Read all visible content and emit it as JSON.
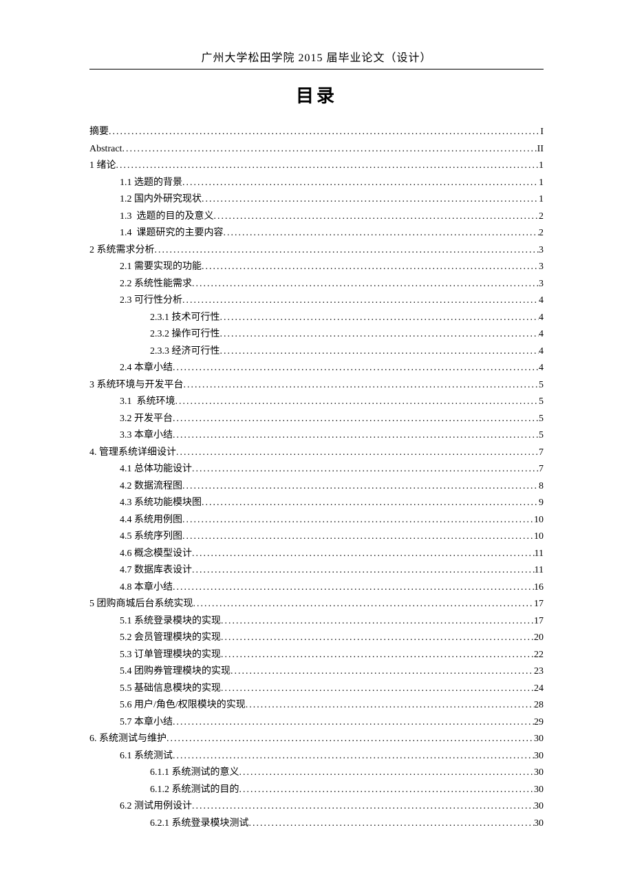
{
  "header": "广州大学松田学院 2015 届毕业论文（设计）",
  "title": "目录",
  "toc": [
    {
      "level": 0,
      "label": "摘要",
      "page": "I"
    },
    {
      "level": 0,
      "label": "Abstract",
      "page": "II"
    },
    {
      "level": 0,
      "label": "1 绪论",
      "page": "1"
    },
    {
      "level": 1,
      "label": "1.1 选题的背景",
      "page": "1"
    },
    {
      "level": 1,
      "label": "1.2 国内外研究现状",
      "page": "1"
    },
    {
      "level": 1,
      "label": "1.3  选题的目的及意义",
      "page": "2"
    },
    {
      "level": 1,
      "label": "1.4  课题研究的主要内容",
      "page": "2"
    },
    {
      "level": 0,
      "label": "2 系统需求分析",
      "page": "3"
    },
    {
      "level": 1,
      "label": "2.1 需要实现的功能",
      "page": "3"
    },
    {
      "level": 1,
      "label": "2.2 系统性能需求",
      "page": "3"
    },
    {
      "level": 1,
      "label": "2.3 可行性分析",
      "page": "4"
    },
    {
      "level": 2,
      "label": "2.3.1 技术可行性",
      "page": "4"
    },
    {
      "level": 2,
      "label": "2.3.2 操作可行性",
      "page": "4"
    },
    {
      "level": 2,
      "label": "2.3.3 经济可行性",
      "page": "4"
    },
    {
      "level": 1,
      "label": "2.4 本章小结",
      "page": "4"
    },
    {
      "level": 0,
      "label": "3 系统环境与开发平台",
      "page": "5"
    },
    {
      "level": 1,
      "label": "3.1  系统环境",
      "page": "5"
    },
    {
      "level": 1,
      "label": "3.2 开发平台",
      "page": "5"
    },
    {
      "level": 1,
      "label": "3.3 本章小结",
      "page": "5"
    },
    {
      "level": 0,
      "label": "4. 管理系统详细设计",
      "page": "7"
    },
    {
      "level": 1,
      "label": "4.1 总体功能设计",
      "page": "7"
    },
    {
      "level": 1,
      "label": "4.2 数据流程图",
      "page": "8"
    },
    {
      "level": 1,
      "label": "4.3 系统功能模块图",
      "page": "9"
    },
    {
      "level": 1,
      "label": "4.4 系统用例图",
      "page": "10"
    },
    {
      "level": 1,
      "label": "4.5 系统序列图",
      "page": "10"
    },
    {
      "level": 1,
      "label": "4.6 概念模型设计",
      "page": "11"
    },
    {
      "level": 1,
      "label": "4.7 数据库表设计",
      "page": "11"
    },
    {
      "level": 1,
      "label": "4.8 本章小结",
      "page": "16"
    },
    {
      "level": 0,
      "label": "5 团购商城后台系统实现",
      "page": "17"
    },
    {
      "level": 1,
      "label": "5.1 系统登录模块的实现",
      "page": "17"
    },
    {
      "level": 1,
      "label": "5.2 会员管理模块的实现",
      "page": "20"
    },
    {
      "level": 1,
      "label": "5.3 订单管理模块的实现",
      "page": "22"
    },
    {
      "level": 1,
      "label": "5.4 团购券管理模块的实现",
      "page": "23"
    },
    {
      "level": 1,
      "label": "5.5 基础信息模块的实现",
      "page": "24"
    },
    {
      "level": 1,
      "label": "5.6 用户/角色/权限模块的实现",
      "page": "28"
    },
    {
      "level": 1,
      "label": "5.7 本章小结",
      "page": "29"
    },
    {
      "level": 0,
      "label": "6. 系统测试与维护",
      "page": "30"
    },
    {
      "level": 1,
      "label": "6.1 系统测试",
      "page": "30"
    },
    {
      "level": 2,
      "label": "6.1.1 系统测试的意义",
      "page": "30"
    },
    {
      "level": 2,
      "label": "6.1.2 系统测试的目的",
      "page": "30"
    },
    {
      "level": 1,
      "label": "6.2 测试用例设计",
      "page": "30"
    },
    {
      "level": 2,
      "label": "6.2.1 系统登录模块测试",
      "page": "30"
    }
  ]
}
